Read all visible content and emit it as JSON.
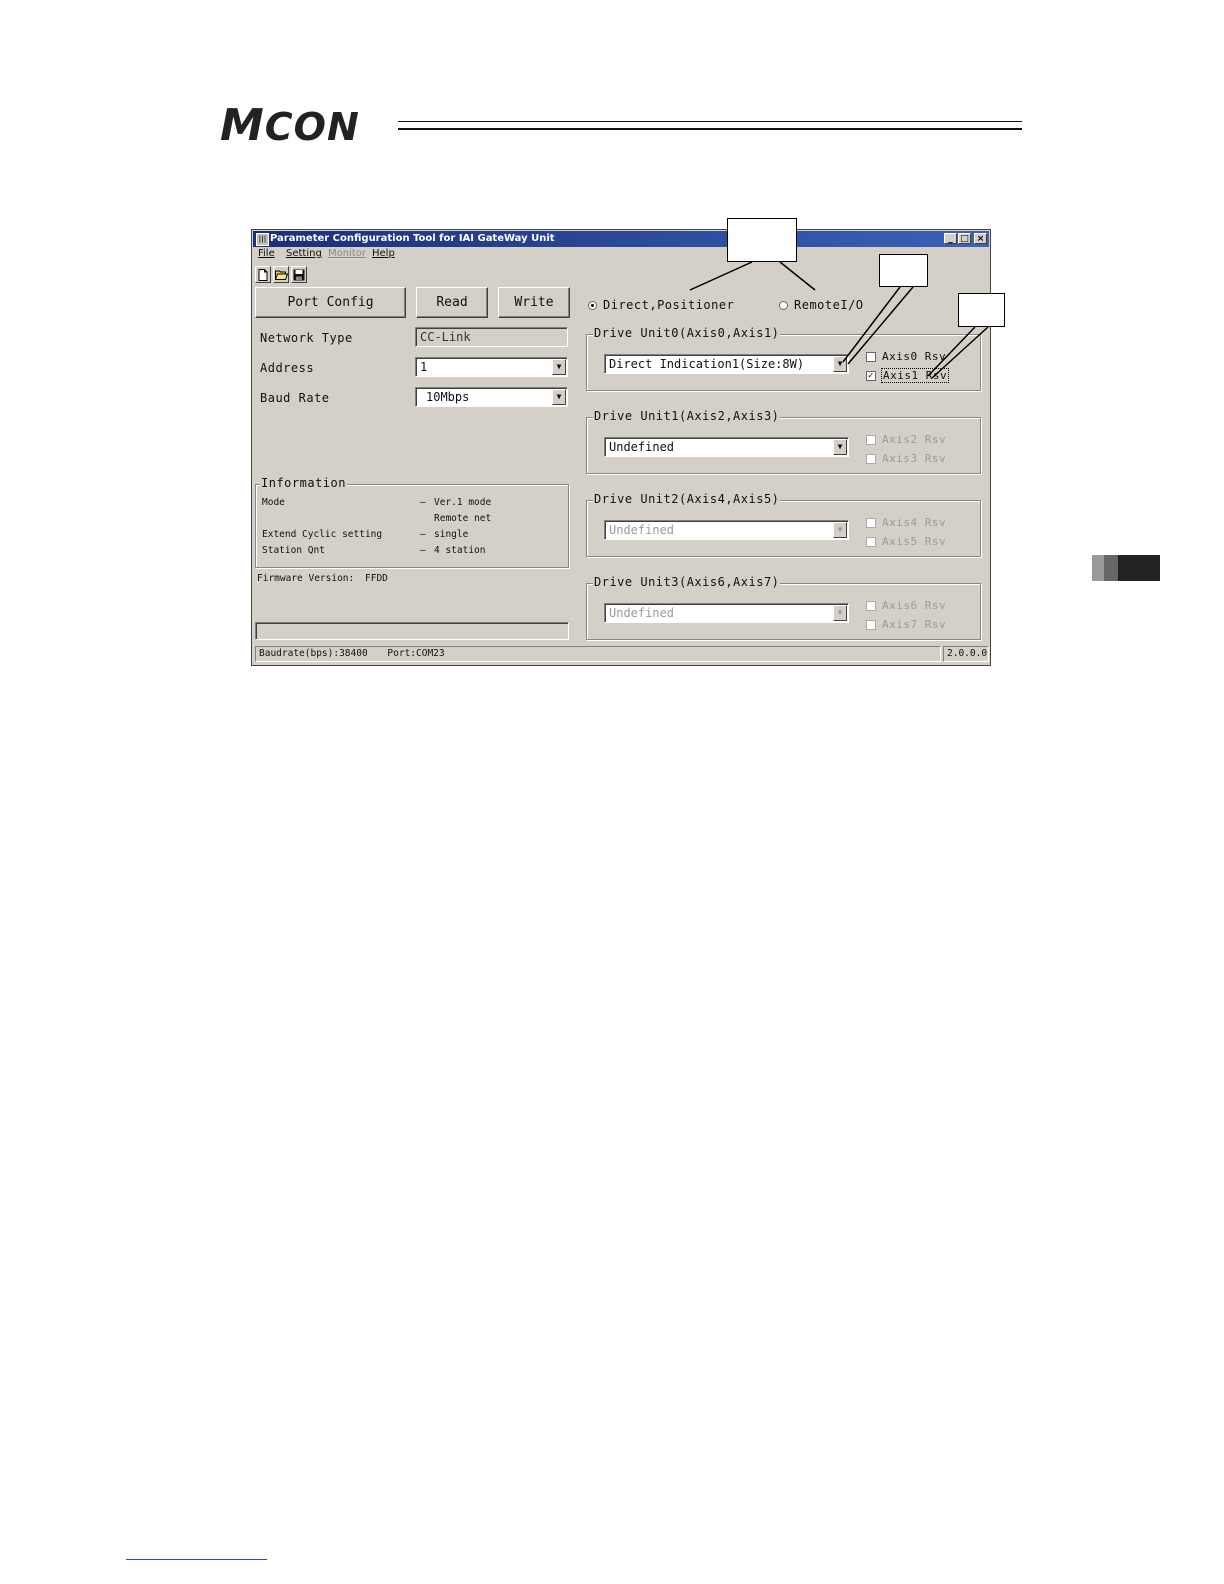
{
  "page": {
    "logo_first": "M",
    "logo_rest": "CON"
  },
  "window": {
    "title": "Parameter Configuration Tool for IAI GateWay Unit",
    "controls": [
      "_",
      "□",
      "×"
    ]
  },
  "menu": [
    {
      "label": "File",
      "enabled": true
    },
    {
      "label": "Setting",
      "enabled": true
    },
    {
      "label": "Monitor",
      "enabled": false
    },
    {
      "label": "Help",
      "enabled": true
    }
  ],
  "toolbar": {
    "icons": [
      "new-file-icon",
      "open-folder-icon",
      "save-disk-icon"
    ]
  },
  "buttons": {
    "port_config": "Port Config",
    "read": "Read",
    "write": "Write"
  },
  "form": {
    "network_type_label": "Network Type",
    "network_type_value": "CC-Link",
    "address_label": "Address",
    "address_value": "1",
    "baud_rate_label": "Baud Rate",
    "baud_rate_value": "10Mbps"
  },
  "information": {
    "title": "Information",
    "rows": [
      {
        "key": "Mode",
        "sep": "–",
        "value": "Ver.1 mode"
      },
      {
        "key": "",
        "sep": "",
        "value": "Remote net"
      },
      {
        "key": "Extend Cyclic setting",
        "sep": "–",
        "value": "single"
      },
      {
        "key": "Station Qnt",
        "sep": "–",
        "value": "4 station"
      }
    ]
  },
  "firmware": {
    "label": "Firmware Version:",
    "value": "FFDD"
  },
  "mode": {
    "option1": "Direct,Positioner",
    "option2": "RemoteI/O",
    "selected": "option1"
  },
  "drive_units": [
    {
      "title": "Drive Unit0(Axis0,Axis1)",
      "value": "Direct Indication1(Size:8W)",
      "enabled": true,
      "checks": [
        {
          "label": "Axis0 Rsv",
          "checked": false,
          "enabled": true
        },
        {
          "label": "Axis1 Rsv",
          "checked": true,
          "enabled": true
        }
      ]
    },
    {
      "title": "Drive Unit1(Axis2,Axis3)",
      "value": "Undefined",
      "enabled": true,
      "checks": [
        {
          "label": "Axis2 Rsv",
          "checked": false,
          "enabled": false
        },
        {
          "label": "Axis3 Rsv",
          "checked": false,
          "enabled": false
        }
      ]
    },
    {
      "title": "Drive Unit2(Axis4,Axis5)",
      "value": "Undefined",
      "enabled": false,
      "checks": [
        {
          "label": "Axis4 Rsv",
          "checked": false,
          "enabled": false
        },
        {
          "label": "Axis5 Rsv",
          "checked": false,
          "enabled": false
        }
      ]
    },
    {
      "title": "Drive Unit3(Axis6,Axis7)",
      "value": "Undefined",
      "enabled": false,
      "checks": [
        {
          "label": "Axis6 Rsv",
          "checked": false,
          "enabled": false
        },
        {
          "label": "Axis7 Rsv",
          "checked": false,
          "enabled": false
        }
      ]
    }
  ],
  "statusbar": {
    "baudrate": "Baudrate(bps):38400",
    "port": "Port:COM23",
    "version": "2.0.0.0"
  }
}
